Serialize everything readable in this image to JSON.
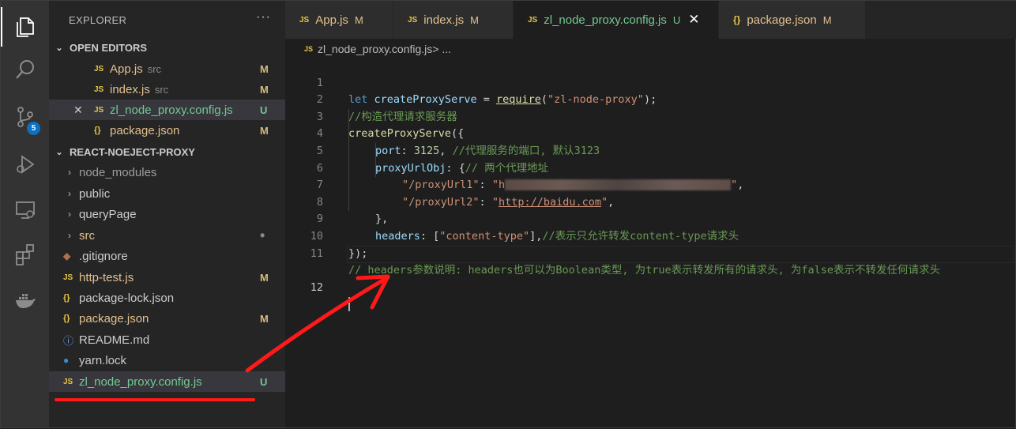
{
  "activity": {
    "scm_badge": "5"
  },
  "sidebar": {
    "title": "EXPLORER",
    "more": "···",
    "open_editors": {
      "header": "OPEN EDITORS",
      "items": [
        {
          "icon": "JS",
          "name": "App.js",
          "dir": "src",
          "status": "M"
        },
        {
          "icon": "JS",
          "name": "index.js",
          "dir": "src",
          "status": "M"
        },
        {
          "icon": "JS",
          "name": "zl_node_proxy.config.js",
          "dir": "",
          "status": "U",
          "close": "✕"
        },
        {
          "icon": "{}",
          "name": "package.json",
          "dir": "",
          "status": "M"
        }
      ]
    },
    "project": {
      "header": "REACT-NOEJECT-PROXY",
      "items": [
        {
          "type": "folder",
          "name": "node_modules",
          "status": ""
        },
        {
          "type": "folder",
          "name": "public",
          "status": ""
        },
        {
          "type": "folder",
          "name": "queryPage",
          "status": ""
        },
        {
          "type": "folder",
          "name": "src",
          "status": "•"
        },
        {
          "type": "git",
          "icon": "◆",
          "name": ".gitignore",
          "status": ""
        },
        {
          "type": "js",
          "icon": "JS",
          "name": "http-test.js",
          "status": "M"
        },
        {
          "type": "json",
          "icon": "{}",
          "name": "package-lock.json",
          "status": ""
        },
        {
          "type": "json",
          "icon": "{}",
          "name": "package.json",
          "status": "M"
        },
        {
          "type": "info",
          "icon": "ⓘ",
          "name": "README.md",
          "status": ""
        },
        {
          "type": "yarn",
          "icon": "🧶",
          "name": "yarn.lock",
          "status": ""
        },
        {
          "type": "js",
          "icon": "JS",
          "name": "zl_node_proxy.config.js",
          "status": "U"
        }
      ]
    }
  },
  "tabs": [
    {
      "icon": "JS",
      "name": "App.js",
      "status": "M"
    },
    {
      "icon": "JS",
      "name": "index.js",
      "status": "M"
    },
    {
      "icon": "JS",
      "name": "zl_node_proxy.config.js",
      "status": "U",
      "close": "✕"
    },
    {
      "icon": "{}",
      "name": "package.json",
      "status": "M"
    }
  ],
  "breadcrumb": {
    "icon": "JS",
    "file": "zl_node_proxy.config.js",
    "rest": " > ..."
  },
  "editor": {
    "line_numbers": [
      "1",
      "2",
      "3",
      "4",
      "5",
      "6",
      "7",
      "8",
      "9",
      "10",
      "11",
      "12"
    ],
    "t": {
      "l1a": "let",
      "l1b": " ",
      "l1c": "createProxyServe",
      "l1d": " = ",
      "l1e": "require",
      "l1f": "(",
      "l1g": "\"zl-node-proxy\"",
      "l1h": ");",
      "l2": "//构造代理请求服务器",
      "l3a": "createProxyServe",
      "l3b": "({",
      "l4a": "port",
      "l4b": ": ",
      "l4c": "3125",
      "l4d": ", ",
      "l4e": "//代理服务的端口, 默认3123",
      "l5a": "proxyUrlObj",
      "l5b": ": {",
      "l5c": "// 两个代理地址",
      "l6a": "\"/proxyUrl1\"",
      "l6b": ": ",
      "l6c": "\"h",
      "l6d": "\"",
      "l6e": ",",
      "l7a": "\"/proxyUrl2\"",
      "l7b": ": ",
      "l7c": "\"",
      "l7d": "http://baidu.com",
      "l7e": "\"",
      "l7f": ",",
      "l8": "},",
      "l9a": "headers",
      "l9b": ": [",
      "l9c": "\"content-type\"",
      "l9d": "],",
      "l9e": "//表示只允许转发content-type请求头",
      "l10": "});",
      "l11": "// headers参数说明: headers也可以为Boolean类型, 为true表示转发所有的请求头, 为false表示不转发任何请求头"
    }
  },
  "colors": {
    "annotation": "#ff1a1a",
    "modified": "#e2c08d",
    "untracked": "#74c991",
    "accent": "#0e70c0"
  }
}
